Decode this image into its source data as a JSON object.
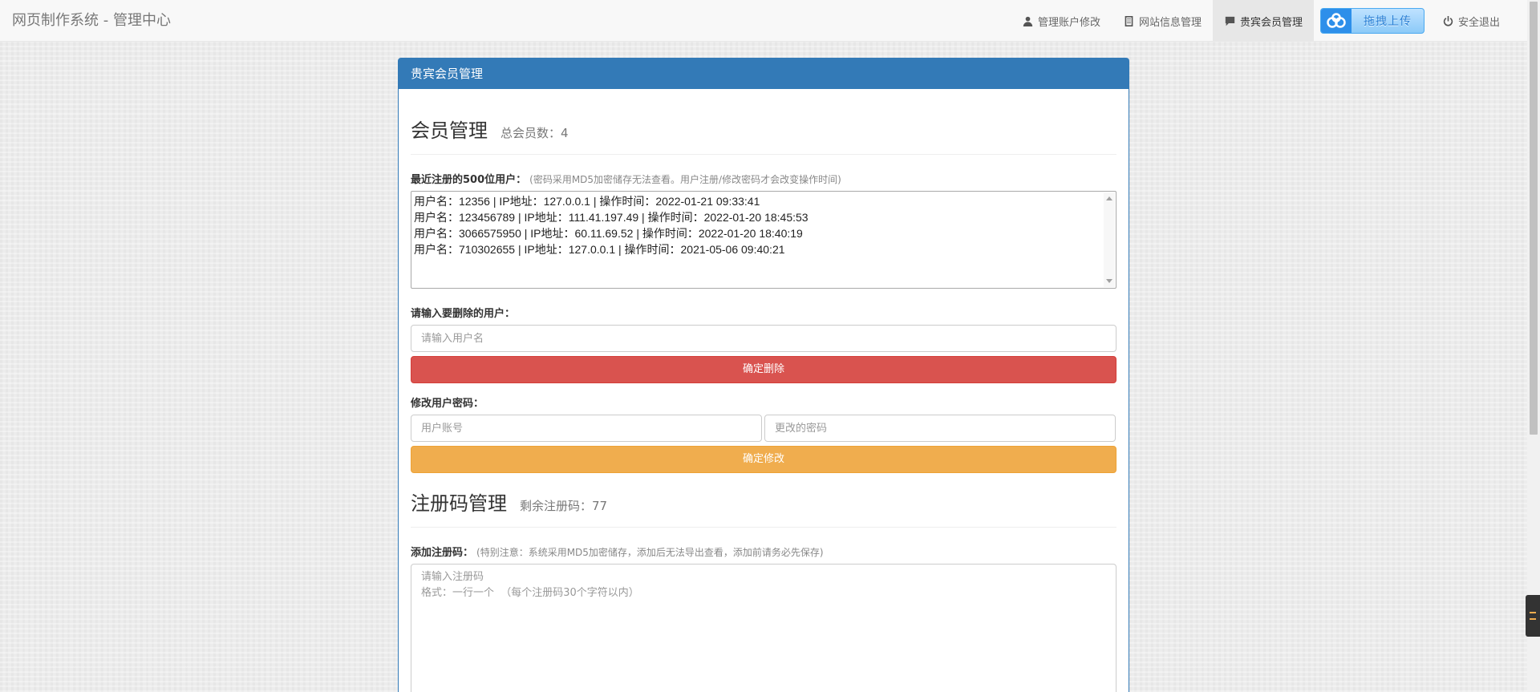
{
  "nav": {
    "brand": "网页制作系统 - 管理中心",
    "items": [
      {
        "label": "管理账户修改",
        "icon": "user-icon"
      },
      {
        "label": "网站信息管理",
        "icon": "document-icon"
      },
      {
        "label": "贵宾会员管理",
        "icon": "comment-icon",
        "active": true
      },
      {
        "label": "安全退出",
        "icon": "power-icon"
      }
    ],
    "upload_label": "拖拽上传"
  },
  "panel": {
    "heading": "贵宾会员管理",
    "member": {
      "title": "会员管理",
      "count_label": "总会员数：4",
      "recent_label": "最近注册的500位用户：",
      "recent_hint": "(密码采用MD5加密储存无法查看。用户注册/修改密码才会改变操作时间)",
      "users": [
        "用户名：12356  |  IP地址：127.0.0.1  |  操作时间：2022-01-21 09:33:41",
        "用户名：123456789  |  IP地址：111.41.197.49  |  操作时间：2022-01-20 18:45:53",
        "用户名：3066575950  |  IP地址：60.11.69.52  |  操作时间：2022-01-20 18:40:19",
        "用户名：710302655  |  IP地址：127.0.0.1  |  操作时间：2021-05-06 09:40:21"
      ],
      "delete_label": "请输入要删除的用户：",
      "delete_placeholder": "请输入用户名",
      "delete_button": "确定删除",
      "modify_label": "修改用户密码：",
      "account_placeholder": "用户账号",
      "password_placeholder": "更改的密码",
      "modify_button": "确定修改"
    },
    "code": {
      "title": "注册码管理",
      "remaining_label": "剩余注册码：77",
      "add_label": "添加注册码：",
      "add_hint": "(特别注意：系统采用MD5加密储存，添加后无法导出查看，添加前请务必先保存)",
      "textarea_placeholder": "请输入注册码\n格式：一行一个  （每个注册码30个字符以内）"
    }
  }
}
